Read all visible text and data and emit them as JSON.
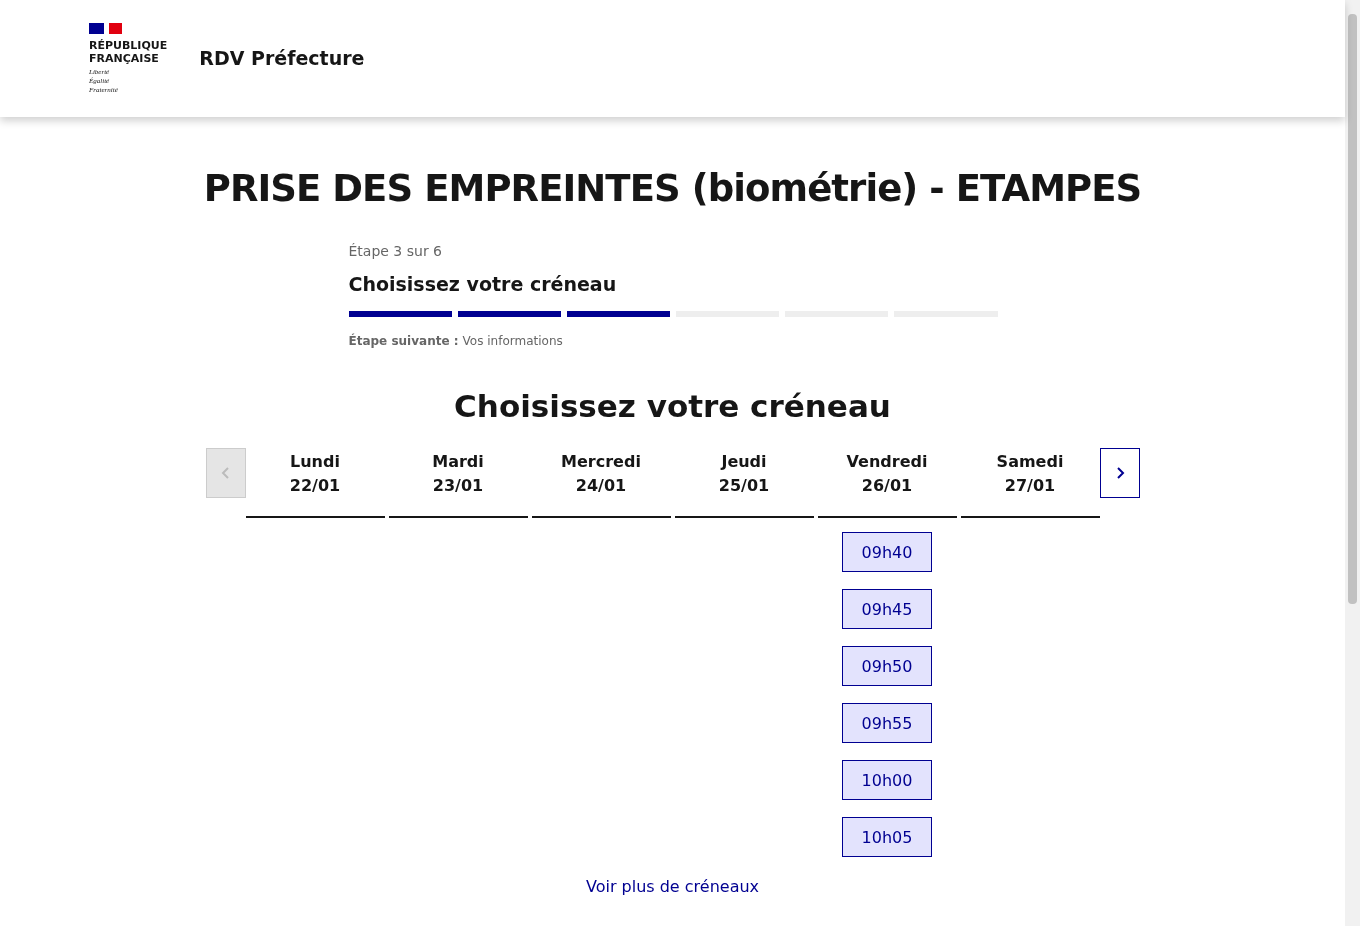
{
  "header": {
    "logo_lines": [
      "RÉPUBLIQUE",
      "FRANÇAISE"
    ],
    "motto": [
      "Liberté",
      "Égalité",
      "Fraternité"
    ],
    "service": "RDV Préfecture"
  },
  "title": "PRISE DES EMPREINTES (biométrie) - ETAMPES",
  "stepper": {
    "counter": "Étape 3 sur 6",
    "current": "Choisissez votre créneau",
    "steps": [
      {
        "done": true
      },
      {
        "done": true
      },
      {
        "done": true
      },
      {
        "done": false
      },
      {
        "done": false
      },
      {
        "done": false
      }
    ],
    "next_label": "Étape suivante :",
    "next_value": "Vos informations"
  },
  "section_title": "Choisissez votre créneau",
  "prev_button": {
    "disabled": true
  },
  "next_button": {
    "disabled": false
  },
  "days": [
    {
      "name": "Lundi",
      "date": "22/01"
    },
    {
      "name": "Mardi",
      "date": "23/01"
    },
    {
      "name": "Mercredi",
      "date": "24/01"
    },
    {
      "name": "Jeudi",
      "date": "25/01"
    },
    {
      "name": "Vendredi",
      "date": "26/01",
      "slots": [
        "09h40",
        "09h45",
        "09h50",
        "09h55",
        "10h00",
        "10h05"
      ]
    },
    {
      "name": "Samedi",
      "date": "27/01"
    }
  ],
  "more_link": "Voir plus de créneaux"
}
